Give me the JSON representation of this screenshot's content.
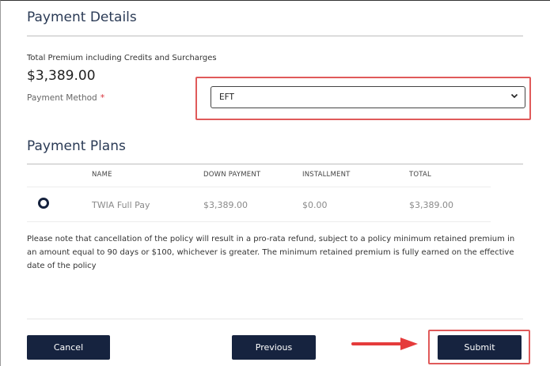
{
  "payment_details": {
    "title": "Payment Details",
    "premium_label": "Total Premium including Credits and Surcharges",
    "premium_value": "$3,389.00",
    "method_label": "Payment Method",
    "required_marker": "*",
    "method_selected": "EFT"
  },
  "payment_plans": {
    "title": "Payment Plans",
    "columns": [
      "NAME",
      "DOWN PAYMENT",
      "INSTALLMENT",
      "TOTAL"
    ],
    "rows": [
      {
        "name": "TWIA Full Pay",
        "down_payment": "$3,389.00",
        "installment": "$0.00",
        "total": "$3,389.00",
        "selected": true
      }
    ]
  },
  "notice": "Please note that cancellation of the policy will result in a pro-rata refund, subject to a policy minimum retained premium in an amount equal to 90 days or $100, whichever is greater. The minimum retained premium is fully earned on the effective date of the policy",
  "buttons": {
    "cancel": "Cancel",
    "previous": "Previous",
    "submit": "Submit"
  },
  "colors": {
    "primary_button": "#16233f",
    "highlight": "#e05a5a",
    "required": "#d8323b"
  }
}
